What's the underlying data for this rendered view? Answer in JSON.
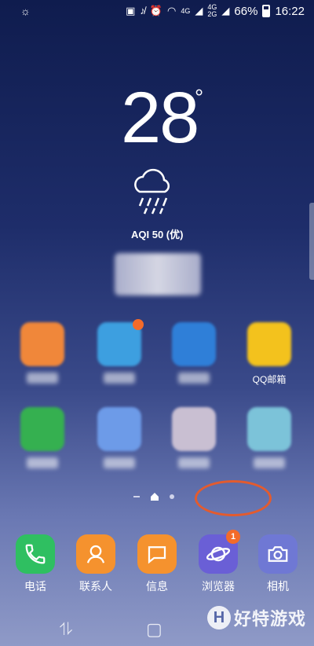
{
  "status": {
    "network_4g": "4G",
    "network_4g2": "4G",
    "network_2g": "2G",
    "battery": "66%",
    "time": "16:22",
    "icons": [
      "brightness-icon",
      "sim-icon",
      "mute-icon",
      "alarm-icon",
      "wifi-icon",
      "signal-icon"
    ]
  },
  "weather": {
    "temperature": "28",
    "degree_symbol": "°",
    "aqi": "AQI 50 (优)",
    "icon": "rain-cloud-icon"
  },
  "apps": [
    {
      "label": "",
      "color": "#f0873a",
      "badge": ""
    },
    {
      "label": "",
      "color": "#3d9fe0",
      "badge": " "
    },
    {
      "label": "",
      "color": "#2f7fd8",
      "badge": ""
    },
    {
      "label": "QQ邮箱",
      "color": "#f3c21d",
      "badge": ""
    },
    {
      "label": "",
      "color": "#35b050",
      "badge": ""
    },
    {
      "label": "",
      "color": "#6d9be8",
      "badge": ""
    },
    {
      "label": "",
      "color": "#c9bfd2",
      "badge": ""
    },
    {
      "label": "",
      "color": "#7cc3d9",
      "badge": ""
    }
  ],
  "dock": [
    {
      "label": "电话",
      "color": "#2fbf61",
      "icon": "phone-icon"
    },
    {
      "label": "联系人",
      "color": "#f5922e",
      "icon": "contacts-icon"
    },
    {
      "label": "信息",
      "color": "#f5922e",
      "icon": "message-icon"
    },
    {
      "label": "浏览器",
      "color": "#6a5fd6",
      "icon": "browser-icon",
      "badge": "1"
    },
    {
      "label": "相机",
      "color": "#6f78d4",
      "icon": "camera-icon"
    }
  ],
  "watermark": {
    "letter": "H",
    "text": "好特游戏"
  },
  "colors": {
    "highlight": "#e35b2e",
    "badge": "#f36b2a"
  }
}
